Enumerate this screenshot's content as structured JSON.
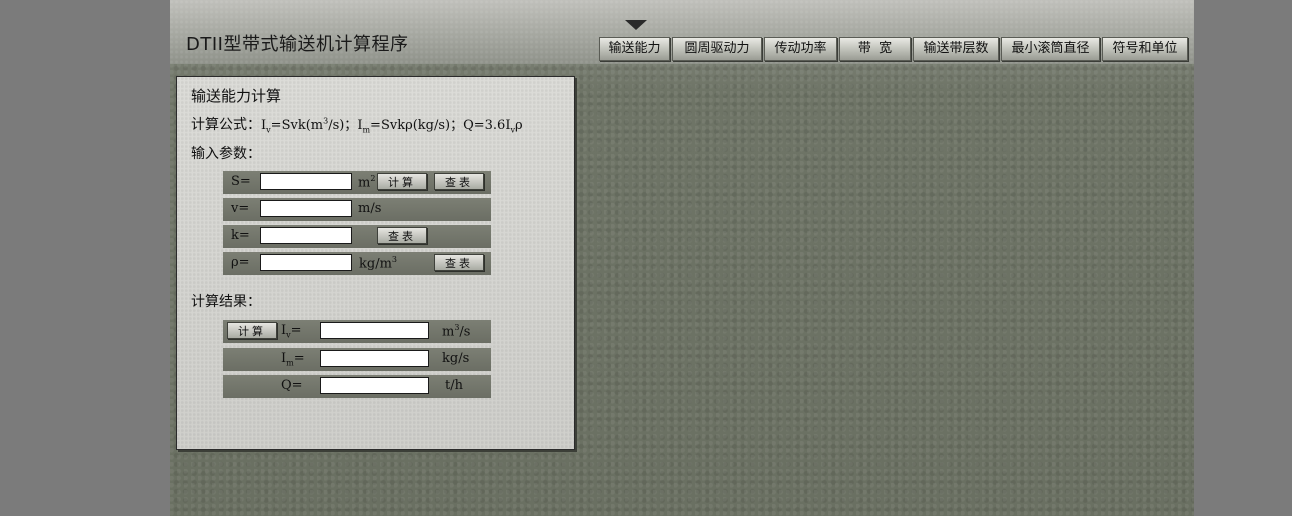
{
  "app": {
    "title": "DTII型带式输送机计算程序"
  },
  "nav": {
    "items": [
      "输送能力",
      "圆周驱动力",
      "传动功率",
      "带  宽",
      "输送带层数",
      "最小滚筒直径",
      "符号和单位"
    ]
  },
  "panel": {
    "title": "输送能力计算",
    "formula_label": "计算公式：",
    "formula": {
      "iv": "I",
      "iv_sub": "v",
      "eq1": "=Svk(m",
      "eq1_sup": "3",
      "eq1_end": "/s)；",
      "im": "I",
      "im_sub": "m",
      "eq2": "=Svkρ(kg/s)；Q=3.6I",
      "eq2_sub": "v",
      "eq2_end": "ρ"
    },
    "input_label": "输入参数：",
    "result_label": "计算结果：",
    "inputs": [
      {
        "label": "S=",
        "unit": "m",
        "unit_sup": "2",
        "value": ""
      },
      {
        "label": "v=",
        "unit": "m/s",
        "value": ""
      },
      {
        "label": "k=",
        "value": ""
      },
      {
        "label": "ρ=",
        "unit": "kg/m",
        "unit_sup": "3",
        "value": ""
      }
    ],
    "calc_button": "计算",
    "lookup_button": "查表",
    "results": [
      {
        "label": "I",
        "label_sub": "v",
        "label_end": "=",
        "unit": "m",
        "unit_sup": "3",
        "unit_end": "/s",
        "value": ""
      },
      {
        "label": "I",
        "label_sub": "m",
        "label_end": "=",
        "unit": "kg/s",
        "value": ""
      },
      {
        "label": "Q=",
        "unit": "t/h",
        "value": ""
      }
    ]
  }
}
